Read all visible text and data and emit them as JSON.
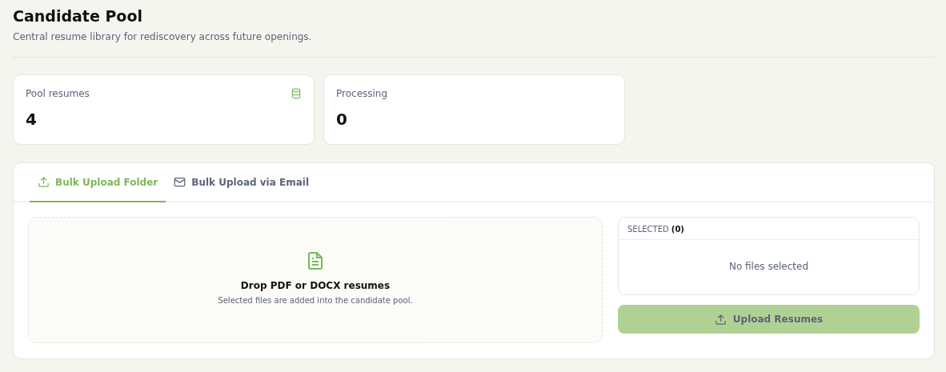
{
  "header": {
    "title": "Candidate Pool",
    "subtitle": "Central resume library for rediscovery across future openings."
  },
  "stats": [
    {
      "label": "Pool resumes",
      "value": "4",
      "kind": "database"
    },
    {
      "label": "Processing",
      "value": "0",
      "kind": "plain"
    }
  ],
  "tabs": [
    {
      "label": "Bulk Upload Folder",
      "kind": "upload",
      "selected": true
    },
    {
      "label": "Bulk Upload via Email",
      "kind": "mail",
      "selected": false
    }
  ],
  "dropzone": {
    "title": "Drop PDF or DOCX resumes",
    "hint": "Selected files are added into the candidate pool."
  },
  "selected_list": {
    "heading": "SELECTED **(0)**",
    "empty_text": "No files selected"
  },
  "upload_button": {
    "label": "Upload Resumes",
    "disabled": true
  }
}
